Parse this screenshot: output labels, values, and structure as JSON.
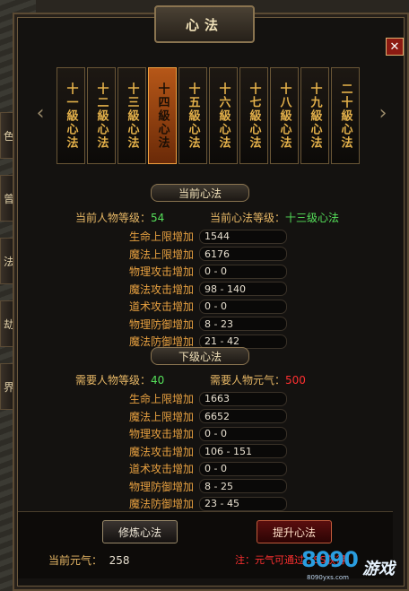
{
  "window": {
    "title": "心法",
    "close_label": "✕"
  },
  "side_tabs": [
    "色",
    "曾",
    "法",
    "劫",
    "界"
  ],
  "skills": [
    {
      "label": "十一級心法",
      "active": false
    },
    {
      "label": "十二級心法",
      "active": false
    },
    {
      "label": "十三級心法",
      "active": false
    },
    {
      "label": "十四級心法",
      "active": true
    },
    {
      "label": "十五級心法",
      "active": false
    },
    {
      "label": "十六級心法",
      "active": false
    },
    {
      "label": "十七級心法",
      "active": false
    },
    {
      "label": "十八級心法",
      "active": false
    },
    {
      "label": "十九級心法",
      "active": false
    },
    {
      "label": "二十級心法",
      "active": false
    }
  ],
  "current": {
    "header": "当前心法",
    "char_level_label": "当前人物等级：",
    "char_level_value": "54",
    "skill_level_label": "当前心法等级：",
    "skill_level_value": "十三级心法",
    "stats": [
      {
        "label": "生命上限增加",
        "value": "1544"
      },
      {
        "label": "魔法上限增加",
        "value": "6176"
      },
      {
        "label": "物理攻击增加",
        "value": "0 - 0"
      },
      {
        "label": "魔法攻击增加",
        "value": "98 - 140"
      },
      {
        "label": "道术攻击增加",
        "value": "0 - 0"
      },
      {
        "label": "物理防御增加",
        "value": "8 - 23"
      },
      {
        "label": "魔法防御增加",
        "value": "21 - 42"
      }
    ]
  },
  "next": {
    "header": "下级心法",
    "req_level_label": "需要人物等级：",
    "req_level_value": "40",
    "req_qi_label": "需要人物元气：",
    "req_qi_value": "500",
    "stats": [
      {
        "label": "生命上限增加",
        "value": "1663"
      },
      {
        "label": "魔法上限增加",
        "value": "6652"
      },
      {
        "label": "物理攻击增加",
        "value": "0 - 0"
      },
      {
        "label": "魔法攻击增加",
        "value": "106 - 151"
      },
      {
        "label": "道术攻击增加",
        "value": "0 - 0"
      },
      {
        "label": "物理防御增加",
        "value": "8 - 25"
      },
      {
        "label": "魔法防御增加",
        "value": "23 - 45"
      }
    ]
  },
  "footer": {
    "train_button": "修炼心法",
    "upgrade_button": "提升心法",
    "qi_label": "当前元气：",
    "qi_value": "258",
    "note": "注：元气可通过...SS获得"
  },
  "watermark": {
    "nums": "8090",
    "brand": "游戏",
    "site": "8090yxs.com"
  },
  "colors": {
    "accent": "#e3b04a",
    "active_card": "#b65718",
    "green": "#55e05a",
    "red": "#ff3030"
  }
}
